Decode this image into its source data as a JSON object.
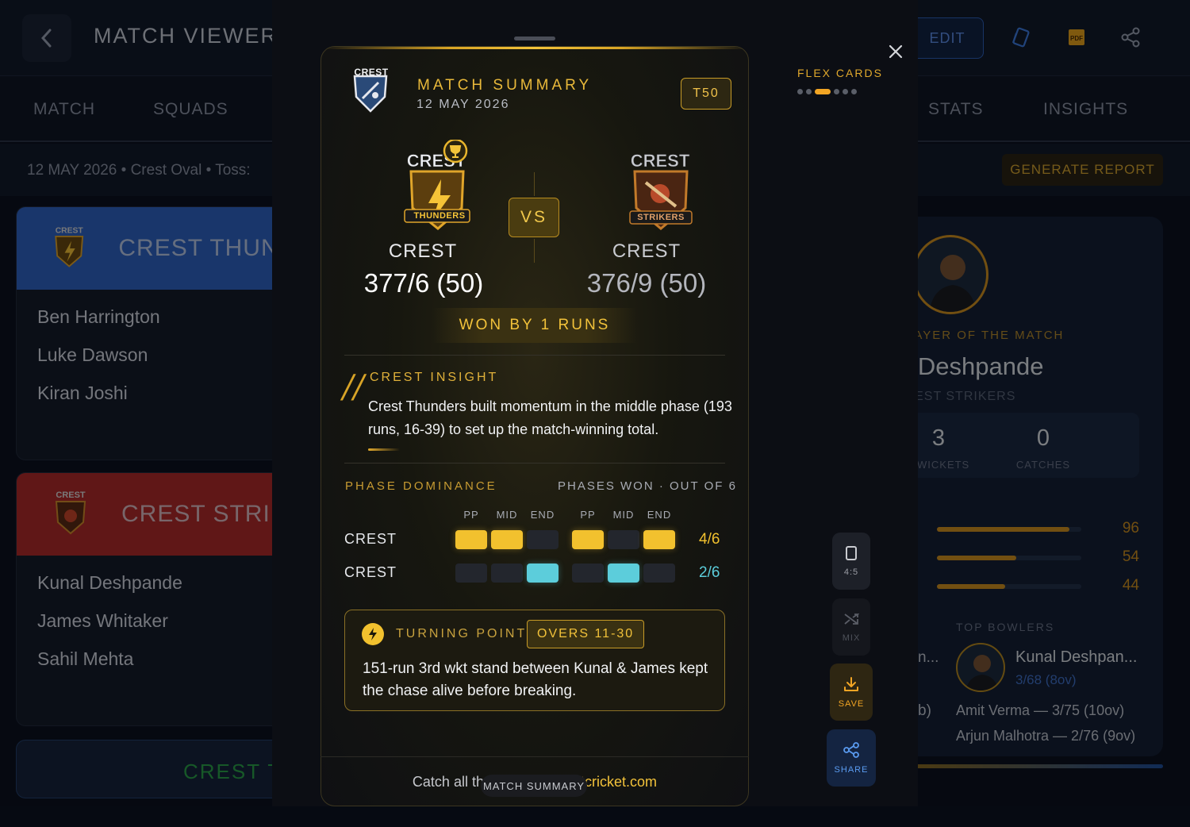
{
  "app": {
    "title": "MATCH VIEWER",
    "edit_label": "EDIT"
  },
  "nav": {
    "tabs": [
      "MATCH",
      "SQUADS",
      "STATS",
      "INSIGHTS"
    ]
  },
  "info": {
    "line": "12 MAY 2026 • Crest Oval • Toss:",
    "generate_label": "GENERATE REPORT"
  },
  "teams": [
    {
      "name": "CREST THUNDERS",
      "players": [
        "Ben Harrington",
        "Luke Dawson",
        "Kiran Joshi"
      ]
    },
    {
      "name": "CREST STRIKERS",
      "players": [
        "Kunal Deshpande",
        "James Whitaker",
        "Sahil Mehta"
      ]
    },
    {
      "name": "CREST THUNDERS"
    }
  ],
  "potm": {
    "label": "PLAYER OF THE MATCH",
    "name": "Kunal Deshpande",
    "team": "CREST STRIKERS",
    "stats": [
      {
        "value": "3",
        "label": "WICKETS"
      },
      {
        "value": "0",
        "label": "CATCHES"
      }
    ],
    "bars": [
      {
        "value": "96",
        "fill": 0.92
      },
      {
        "value": "54",
        "fill": 0.55
      },
      {
        "value": "44",
        "fill": 0.47
      }
    ],
    "top_bowlers_label": "TOP BOWLERS",
    "top_bowler_name": "Kunal Deshpan...",
    "top_bowler_figures": "3/68 (8ov)",
    "other_bowlers": [
      "Amit Verma — 3/75 (10ov)",
      "Arjun Malhotra — 2/76 (9ov)"
    ],
    "left_fragments": [
      "n...",
      "b)"
    ]
  },
  "card": {
    "brand": "CREST",
    "title": "MATCH SUMMARY",
    "date": "12 MAY 2026",
    "format": "T50",
    "vs": "VS",
    "team1": {
      "label": "CREST",
      "score": "377/6 (50)",
      "badge": "THUNDERS",
      "winner": true
    },
    "team2": {
      "label": "CREST",
      "score": "376/9 (50)",
      "badge": "STRIKERS",
      "winner": false
    },
    "result": "WON BY 1 RUNS",
    "insight": {
      "title": "CREST INSIGHT",
      "text": "Crest Thunders built momentum in the middle phase (193 runs, 16-39) to set up the match-winning total."
    },
    "phase": {
      "title": "PHASE DOMINANCE",
      "subtitle": "PHASES WON · OUT OF 6",
      "headers": [
        "PP",
        "MID",
        "END",
        "PP",
        "MID",
        "END"
      ],
      "rows": [
        {
          "label": "CREST",
          "cells": [
            1,
            1,
            0,
            1,
            0,
            1
          ],
          "result": "4/6",
          "color": "#f2c12e"
        },
        {
          "label": "CREST",
          "cells": [
            0,
            0,
            1,
            0,
            1,
            0
          ],
          "result": "2/6",
          "color": "#5ccddb"
        }
      ]
    },
    "turning_point": {
      "title": "TURNING POINT",
      "overs": "OVERS 11-30",
      "text": "151-run 3rd wkt stand between Kunal & James kept the chase alive before breaking."
    },
    "footer_prefix": "Catch all the action at ",
    "footer_link": "crestcricket.com",
    "pill": "MATCH SUMMARY"
  },
  "controls": {
    "flex_cards_label": "FLEX CARDS",
    "active_dot": 2,
    "dot_count": 6,
    "ratio_label": "4:5",
    "mix_label": "MIX",
    "save_label": "SAVE",
    "share_label": "SHARE"
  },
  "colors": {
    "accent_gold": "#f2c12e",
    "accent_cyan": "#5ccddb",
    "thunders_blue": "#2f63c4",
    "strikers_red": "#b02a2a"
  }
}
